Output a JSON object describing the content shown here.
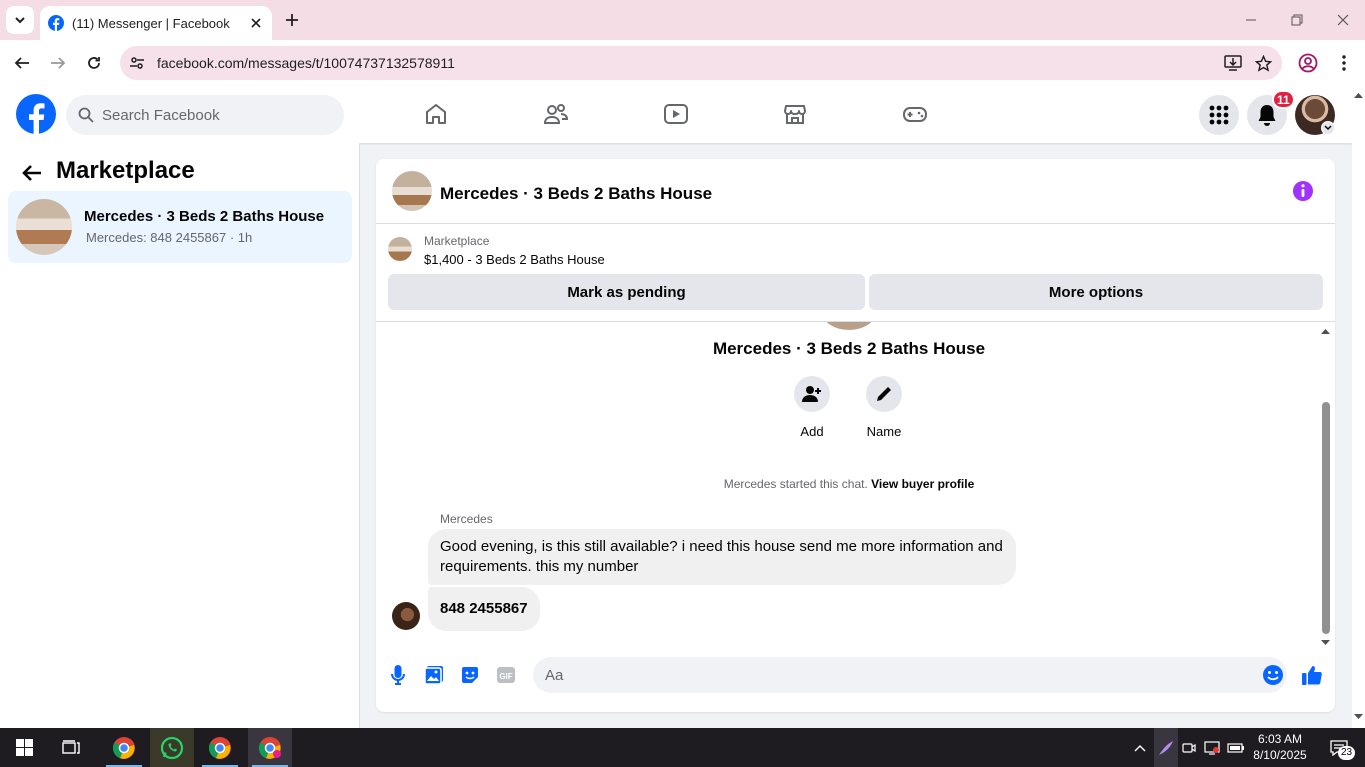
{
  "browser": {
    "tab_title": "(11) Messenger | Facebook",
    "url": "facebook.com/messages/t/10074737132578911"
  },
  "fb": {
    "search_placeholder": "Search Facebook",
    "notifications_count": "11",
    "nav_icons": [
      "home-icon",
      "friends-icon",
      "watch-icon",
      "marketplace-icon",
      "gaming-icon"
    ]
  },
  "sidebar": {
    "title": "Marketplace",
    "conversation": {
      "title": "Mercedes · 3 Beds 2 Baths House",
      "subtitle": "Mercedes: 848 2455867 · 1h"
    }
  },
  "chat": {
    "header_title": "Mercedes · 3 Beds 2 Baths House",
    "listing": {
      "label": "Marketplace",
      "price_title": "$1,400 - 3 Beds 2 Baths House",
      "mark_pending": "Mark as pending",
      "more_options": "More options"
    },
    "thread_name": "Mercedes · 3 Beds 2 Baths House",
    "actions": {
      "add": "Add",
      "name": "Name"
    },
    "started_text": "Mercedes started this chat. ",
    "view_buyer_profile": "View buyer profile",
    "sender": "Mercedes",
    "messages": [
      "Good evening, is this still available? i need this house send me  more information and requirements. this my number",
      "848 2455867"
    ],
    "composer_placeholder": "Aa"
  },
  "taskbar": {
    "time": "6:03 AM",
    "date": "8/10/2025",
    "notif_count": "23"
  },
  "colors": {
    "fb_blue": "#0866ff",
    "messenger_purple": "#a033ff",
    "tab_strip": "#f5dde6",
    "notification_red": "#e41e3f"
  }
}
